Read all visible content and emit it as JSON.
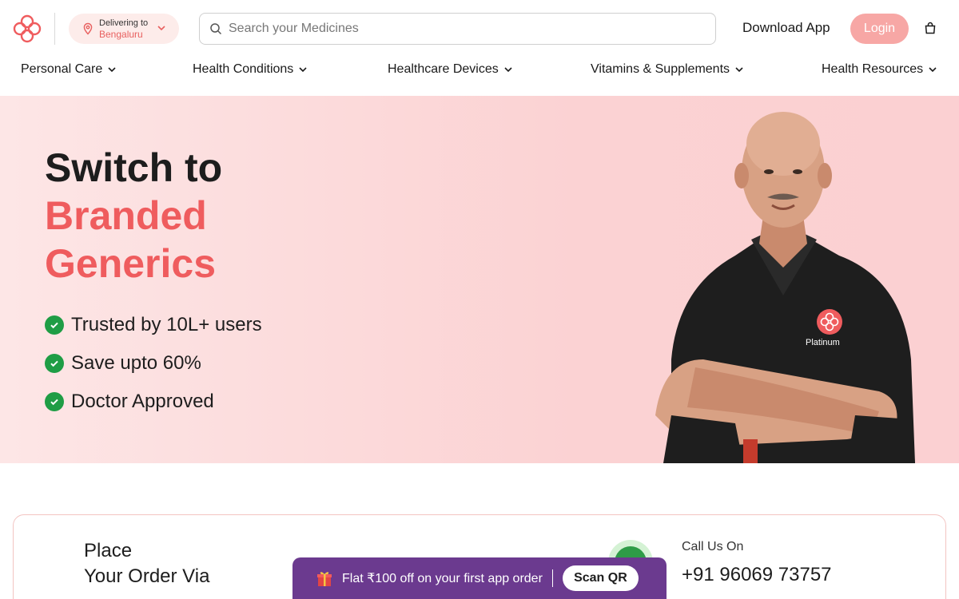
{
  "header": {
    "location": {
      "label": "Delivering to",
      "city": "Bengaluru"
    },
    "search": {
      "placeholder": "Search your Medicines",
      "value": ""
    },
    "download_label": "Download App",
    "login_label": "Login"
  },
  "nav": {
    "items": [
      {
        "label": "Personal Care"
      },
      {
        "label": "Health Conditions"
      },
      {
        "label": "Healthcare Devices"
      },
      {
        "label": "Vitamins & Supplements"
      },
      {
        "label": "Health Resources"
      }
    ]
  },
  "hero": {
    "line1": "Switch to",
    "line2": "Branded",
    "line3": "Generics",
    "bullets": [
      "Trusted by 10L+ users",
      "Save upto 60%",
      "Doctor Approved"
    ],
    "shirt_text": "Platinum"
  },
  "order": {
    "place_line1": "Place",
    "place_line2": "Your Order Via",
    "call_label": "Call Us On",
    "call_number": "+91 96069 73757"
  },
  "promo": {
    "text": "Flat ₹100 off on your first app order",
    "button_label": "Scan QR"
  },
  "colors": {
    "brand": "#ef5c5e",
    "login_bg": "#f7a7a5",
    "hero_bg": "#fbd2d3",
    "check_green": "#1f9d45",
    "promo_bg": "#6b3a8f"
  },
  "icons": [
    "logo-icon",
    "location-pin-icon",
    "chevron-down-icon",
    "search-icon",
    "cart-icon",
    "check-icon",
    "phone-icon",
    "gift-icon"
  ]
}
